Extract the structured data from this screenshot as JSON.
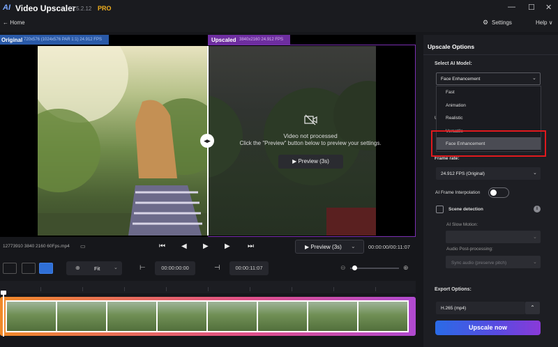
{
  "app": {
    "title": "Video Upscaler",
    "version": "27.5.2.12",
    "badge": "PRO",
    "logo": "AI"
  },
  "window": {
    "minimize": "—",
    "maximize": "☐",
    "close": "✕"
  },
  "nav": {
    "back_label": "← Home",
    "settings_label": "Settings",
    "help_label": "Help ∨"
  },
  "preview": {
    "original_label": "Original",
    "original_meta": "720x576 (1024x576 PAR 1:1) 24.912 FPS",
    "upscaled_label": "Upscaled",
    "upscaled_meta": "3840x2160 24.912 FPS",
    "not_processed_title": "Video not processed",
    "not_processed_msg": "Click the \"Preview\" button below to preview your settings.",
    "overlay_preview_btn": "Preview (3s)"
  },
  "playback": {
    "file_info": "12773910 3840 2160 60Fps.mp4",
    "preview_btn": "Preview (3s)",
    "time": "00:00:00/00:11:07"
  },
  "toolbar": {
    "zoom_value": "Fit",
    "in_time": "00:00:00:00",
    "out_time": "00:00:11:07"
  },
  "panel": {
    "title": "Upscale Options",
    "model_label": "Select AI Model:",
    "model_value": "Face Enhancement",
    "model_options": [
      "Fast",
      "Animation",
      "Realistic",
      "Versatile",
      "Face Enhancement"
    ],
    "covered_label": "U",
    "frame_rate_label": "Frame rate:",
    "frame_rate_value": "24.912 FPS (Original)",
    "interp_label": "AI Frame Interpolation",
    "interp_on": false,
    "scene_label": "Scene detection",
    "slowmo_label": "AI Slow Motion:",
    "audio_label": "Audio Post-processing:",
    "audio_value": "Sync audio (preserve pitch)",
    "export_label": "Export Options:",
    "export_value": "H.265 (mp4)",
    "upscale_btn": "Upscale now"
  },
  "icons": [
    "logo-icon",
    "back-arrow-icon",
    "settings-icon",
    "video-off-icon",
    "play-icon",
    "folder-icon",
    "skip-start-icon",
    "step-back-icon",
    "step-forward-icon",
    "skip-end-icon",
    "zoom-icon",
    "info-icon"
  ],
  "colors": {
    "accent_blue": "#2a5aa8",
    "accent_purple": "#6e2ea0",
    "highlight_red": "#e0191d",
    "pro": "#f2b01e"
  }
}
